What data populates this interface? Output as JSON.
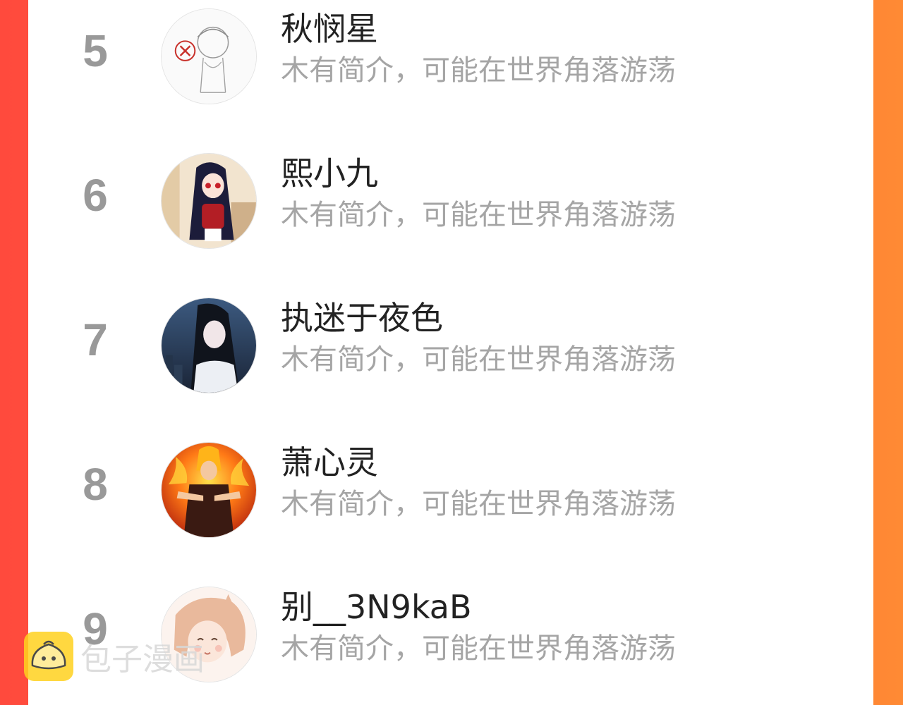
{
  "colors": {
    "accent_left": "#ff4a3d",
    "accent_right": "#ff8a34",
    "rank_gray": "#999999",
    "bio_gray": "#a5a5a5",
    "name_dark": "#222222",
    "logo_yellow": "#ffd21f"
  },
  "ranking": [
    {
      "rank": "5",
      "name": "秋悯星",
      "bio": "木有简介，可能在世界角落游荡",
      "avatar_icon": "sketch-chibi-avatar"
    },
    {
      "rank": "6",
      "name": "熙小九",
      "bio": "木有简介，可能在世界角落游荡",
      "avatar_icon": "chibi-dark-hair-avatar"
    },
    {
      "rank": "7",
      "name": "执迷于夜色",
      "bio": "木有简介，可能在世界角落游荡",
      "avatar_icon": "night-portrait-avatar"
    },
    {
      "rank": "8",
      "name": "萧心灵",
      "bio": "木有简介，可能在世界角落游荡",
      "avatar_icon": "flame-warrior-avatar"
    },
    {
      "rank": "9",
      "name": "别__3N9kaB",
      "bio": "木有简介，可能在世界角落游荡",
      "avatar_icon": "soft-anime-girl-avatar"
    }
  ],
  "watermark": {
    "text": "包子漫画",
    "icon": "bun-logo-icon"
  }
}
